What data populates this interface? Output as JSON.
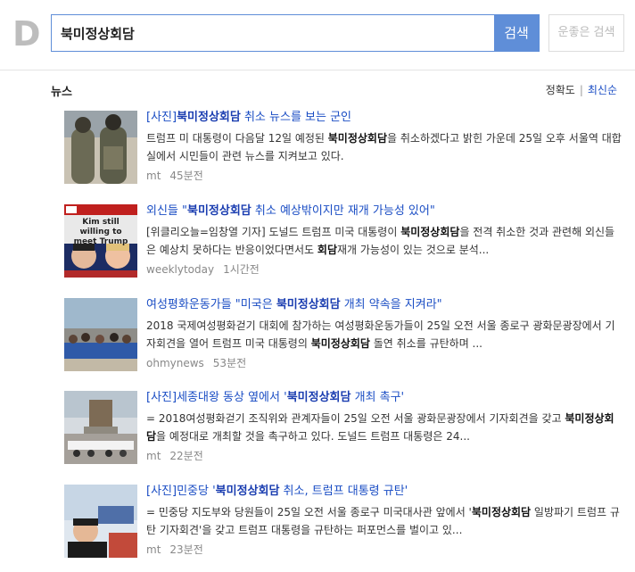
{
  "logo": "D",
  "search": {
    "value": "북미정상회담",
    "button": "검색",
    "lucky": "운좋은 검색"
  },
  "section": {
    "title": "뉴스",
    "sort": [
      "정확도",
      "최신순"
    ]
  },
  "news": [
    {
      "title_pre": "[사진]",
      "title_bold": "북미정상회담",
      "title_post": " 취소 뉴스를 보는 군인",
      "desc_a": "트럼프 미 대통령이 다음달 12일 예정된 ",
      "desc_b": "북미정상회담",
      "desc_c": "을 취소하겠다고 밝힌 가운데 25일 오후 서울역 대합실에서 시민들이 관련 뉴스를 지켜보고 있다.",
      "source": "mt",
      "time": "45분전"
    },
    {
      "title_pre": "외신들 \"",
      "title_bold": "북미정상회담",
      "title_post": " 취소 예상밖이지만 재개 가능성 있어\"",
      "thumb_text": "Kim still willing to meet Trump",
      "desc_a": "[위클리오늘=임창열 기자] 도널드 트럼프 미국 대통령이 ",
      "desc_b": "북미정상회담",
      "desc_c": "을 전격 취소한 것과 관련해 외신들은 예상치 못하다는 반응이었다면서도 ",
      "desc_d": "회담",
      "desc_e": "재개 가능성이 있는 것으로 분석...",
      "source": "weeklytoday",
      "time": "1시간전"
    },
    {
      "title_pre": "여성평화운동가들 \"미국은 ",
      "title_bold": "북미정상회담",
      "title_post": " 개최 약속을 지켜라\"",
      "desc_a": "2018 국제여성평화걷기 대회에 참가하는 여성평화운동가들이 25일 오전 서울 종로구 광화문광장에서 기자회견을 열어 트럼프 미국 대통령의 ",
      "desc_b": "북미정상회담",
      "desc_c": " 돌연 취소를 규탄하며 ...",
      "source": "ohmynews",
      "time": "53분전"
    },
    {
      "title_pre": "[사진]세종대왕 동상 옆에서 '",
      "title_bold": "북미정상회담",
      "title_post": " 개최 촉구'",
      "desc_a": "= 2018여성평화걷기 조직위와 관계자들이 25일 오전 서울 광화문광장에서 기자회견을 갖고 ",
      "desc_b": "북미정상회담",
      "desc_c": "을 예정대로 개최할 것을 촉구하고 있다. 도널드 트럼프 대통령은 24...",
      "source": "mt",
      "time": "22분전"
    },
    {
      "title_pre": "[사진]민중당 '",
      "title_bold": "북미정상회담",
      "title_post": " 취소, 트럼프 대통령 규탄'",
      "desc_a": "= 민중당 지도부와 당원들이 25일 오전 서울 종로구 미국대사관 앞에서 '",
      "desc_b": "북미정상회담",
      "desc_c": " 일방파기 트럼프 규탄 기자회견'을 갖고 트럼프 대통령을 규탄하는 퍼포먼스를 벌이고 있...",
      "source": "mt",
      "time": "23분전"
    }
  ]
}
